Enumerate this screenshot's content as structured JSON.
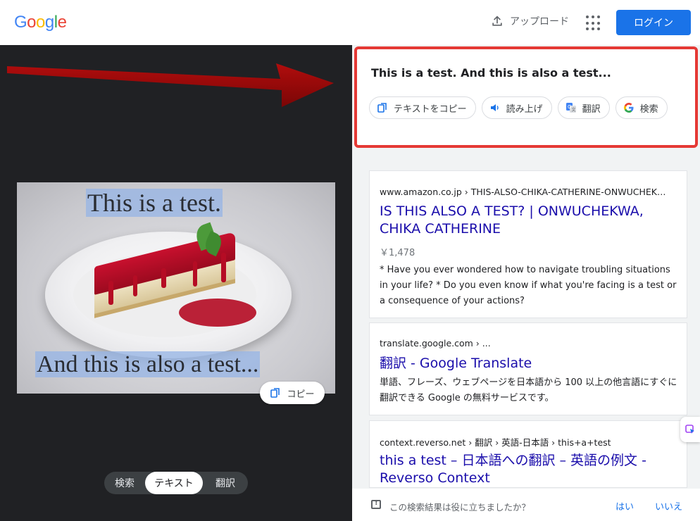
{
  "header": {
    "logo_letters": [
      {
        "ch": "G",
        "color": "#4285F4"
      },
      {
        "ch": "o",
        "color": "#EA4335"
      },
      {
        "ch": "o",
        "color": "#FBBC05"
      },
      {
        "ch": "g",
        "color": "#4285F4"
      },
      {
        "ch": "l",
        "color": "#34A853"
      },
      {
        "ch": "e",
        "color": "#EA4335"
      }
    ],
    "upload_label": "アップロード",
    "upload_icon": "upload-icon",
    "apps_icon": "apps-grid-icon",
    "login_label": "ログイン"
  },
  "image": {
    "ocr_line1": "This is a test.",
    "ocr_line2": "And this is also a test...",
    "copy_label": "コピー"
  },
  "modes": {
    "search": "検索",
    "text": "テキスト",
    "translate": "翻訳",
    "selected": "text"
  },
  "extract": {
    "text": "This is a test. And this is also a test...",
    "chips": {
      "copy": "テキストをコピー",
      "listen": "読み上げ",
      "translate": "翻訳",
      "search": "検索"
    }
  },
  "results": [
    {
      "crumb": "www.amazon.co.jp › THIS-ALSO-CHIKA-CATHERINE-ONWUCHEK…",
      "title": "IS THIS ALSO A TEST? | ONWUCHEKWA, CHIKA CATHERINE",
      "price": "￥1,478",
      "snippet": "* Have you ever wondered how to navigate troubling situations in your life? * Do you even know if what you're facing is a test or a consequence of your actions?"
    },
    {
      "crumb": "translate.google.com › ...",
      "title": "翻訳 - Google Translate",
      "snippet": "単語、フレーズ、ウェブページを日本語から 100 以上の他言語にすぐに翻訳できる Google の無料サービスです。"
    },
    {
      "crumb": "context.reverso.net › 翻訳 › 英語-日本語 › this+a+test",
      "title": "this a test – 日本語への翻訳 – 英語の例文 - Reverso Context"
    }
  ],
  "feedback": {
    "question": "この検索結果は役に立ちましたか？",
    "yes": "はい",
    "no": "いいえ"
  },
  "colors": {
    "accent": "#1a73e8",
    "link": "#1a0dab",
    "annotation_red": "#e53935",
    "dark_panel": "#202124"
  }
}
